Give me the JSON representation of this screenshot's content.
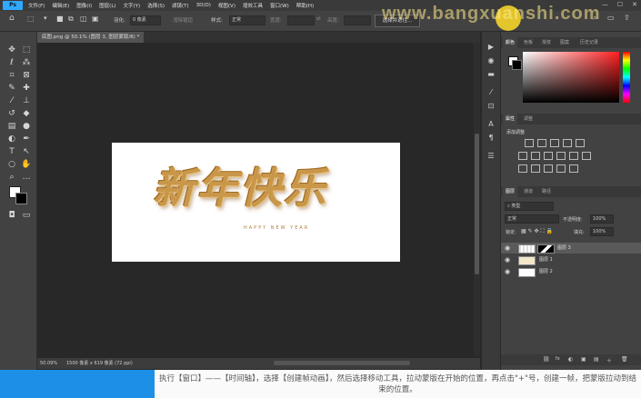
{
  "menu": {
    "logo": "Ps",
    "items": [
      "文件(F)",
      "编辑(E)",
      "图像(I)",
      "图层(L)",
      "文字(Y)",
      "选择(S)",
      "滤镜(T)",
      "3D(D)",
      "视图(V)",
      "增效工具",
      "窗口(W)",
      "帮助(H)"
    ],
    "window_controls": [
      "—",
      "☐",
      "✕"
    ]
  },
  "options": {
    "feather_label": "羽化:",
    "feather_value": "0 像素",
    "antialias": "消除锯齿",
    "style_label": "样式:",
    "style_value": "正常",
    "width_label": "宽度:",
    "height_label": "高度:",
    "select_mask": "选择并遮住..."
  },
  "watermark": "www.bangxuanshi.com",
  "document": {
    "tab_title": "底图.png @ 50.1% (图层 3, 图层蒙版/8) *",
    "zoom": "50.09%",
    "size_info": "1500 像素 x 619 像素 (72 ppi)"
  },
  "artwork": {
    "title": "新年快乐",
    "subtitle": "HAPPY NEW YEAR"
  },
  "panels": {
    "color_tabs": [
      "颜色",
      "色板",
      "渐变",
      "图案",
      "历史记录"
    ],
    "adjust_tabs": [
      "属性",
      "调整"
    ],
    "adjust_label": "添加调整",
    "layer_tabs": [
      "图层",
      "通道",
      "路径"
    ],
    "layer_kind": "类型",
    "blend_mode": "正常",
    "opacity_label": "不透明度:",
    "opacity_value": "100%",
    "lock_label": "锁定:",
    "fill_label": "填充:",
    "fill_value": "100%",
    "layers": [
      "图层 3",
      "图层 1",
      "图层 2"
    ],
    "footer_icons": [
      "⛓",
      "fx",
      "◐",
      "▣",
      "▤",
      "＋",
      "🗑"
    ]
  },
  "caption": "执行【窗口】——【时间轴】，选择【创建帧动画】，然后选择移动工具，拉动蒙版在开始的位置，再点击\"+\"号，创建一帧，把蒙版拉动到结束的位置。"
}
